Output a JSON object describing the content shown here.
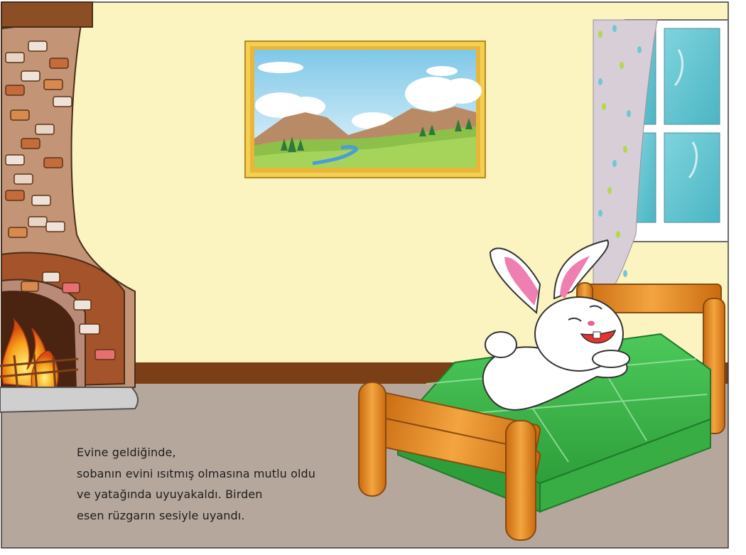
{
  "story": {
    "lines": [
      "Evine geldiğinde,",
      "sobanın evini ısıtmış olmasına mutlu oldu",
      "ve yatağında uyuyakaldı. Birden",
      "esen rüzgarın sesiyle uyandı."
    ]
  },
  "colors": {
    "wall": "#fbf3c0",
    "floor": "#b6a79c",
    "baseboard": "#7a3f17",
    "brick_chimney": "#c39475",
    "fire": "#f6a51a",
    "bed_wood": "#e08a1e",
    "blanket": "#3dbb49",
    "window_glass": "#63c6d1",
    "curtain": "#d7ced7",
    "frame_gold": "#f1c84a"
  },
  "scene": {
    "items": [
      "fireplace",
      "painting",
      "window",
      "curtain",
      "bed",
      "bunny"
    ]
  }
}
